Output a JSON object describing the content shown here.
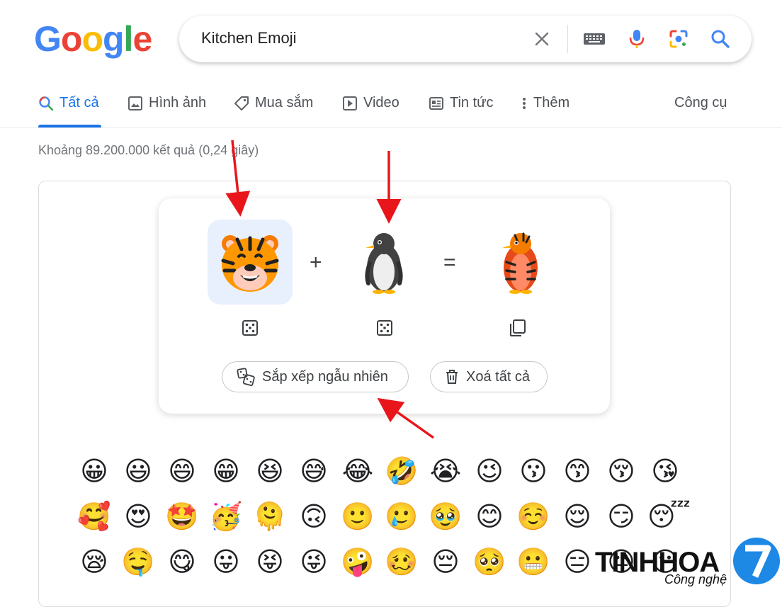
{
  "logo": {
    "g1": "G",
    "o1": "o",
    "o2": "o",
    "g2": "g",
    "l": "l",
    "e": "e"
  },
  "search": {
    "query": "Kitchen Emoji"
  },
  "search_icons": [
    "close-icon",
    "keyboard-icon",
    "microphone-icon",
    "google-lens-icon",
    "search-icon"
  ],
  "tabs": [
    {
      "label": "Tất cả",
      "icon": "search-icon"
    },
    {
      "label": "Hình ảnh",
      "icon": "image-icon"
    },
    {
      "label": "Mua sắm",
      "icon": "tag-icon"
    },
    {
      "label": "Video",
      "icon": "play-icon"
    },
    {
      "label": "Tin tức",
      "icon": "news-icon"
    },
    {
      "label": "Thêm",
      "icon": "more-vert-icon"
    }
  ],
  "tools_label": "Công cụ",
  "results_count": "Khoảng 89.200.000 kết quả (0,24 giây)",
  "kitchen": {
    "emoji1": "🐯",
    "plus": "+",
    "emoji2": "🐧",
    "equals": "=",
    "result": "🐦",
    "randomize_label": "Sắp xếp ngẫu nhiên",
    "clear_label": "Xoá tất cả"
  },
  "emoji_rows": [
    [
      "😀",
      "😃",
      "😄",
      "😁",
      "😆",
      "😅",
      "😂",
      "🤣",
      "😭",
      "😉",
      "😗",
      "😙",
      "😚",
      "😘"
    ],
    [
      "🥰",
      "😍",
      "🤩",
      "🥳",
      "🫠",
      "🙃",
      "🙂",
      "🥲",
      "🥹",
      "😊",
      "☺️",
      "😌",
      "😏",
      "😴"
    ],
    [
      "😪",
      "🤤",
      "😋",
      "😛",
      "😝",
      "😜",
      "🤪",
      "🥴",
      "😔",
      "🥺",
      "😬",
      "😑",
      "😐",
      "😶"
    ]
  ],
  "watermark": {
    "brand": "TINHHOA",
    "sub": "Công nghệ",
    "badge": "7"
  },
  "colors": {
    "accent": "#1a73e8",
    "arrow": "#e8161b",
    "selected_slot": "#e8f0fe"
  }
}
